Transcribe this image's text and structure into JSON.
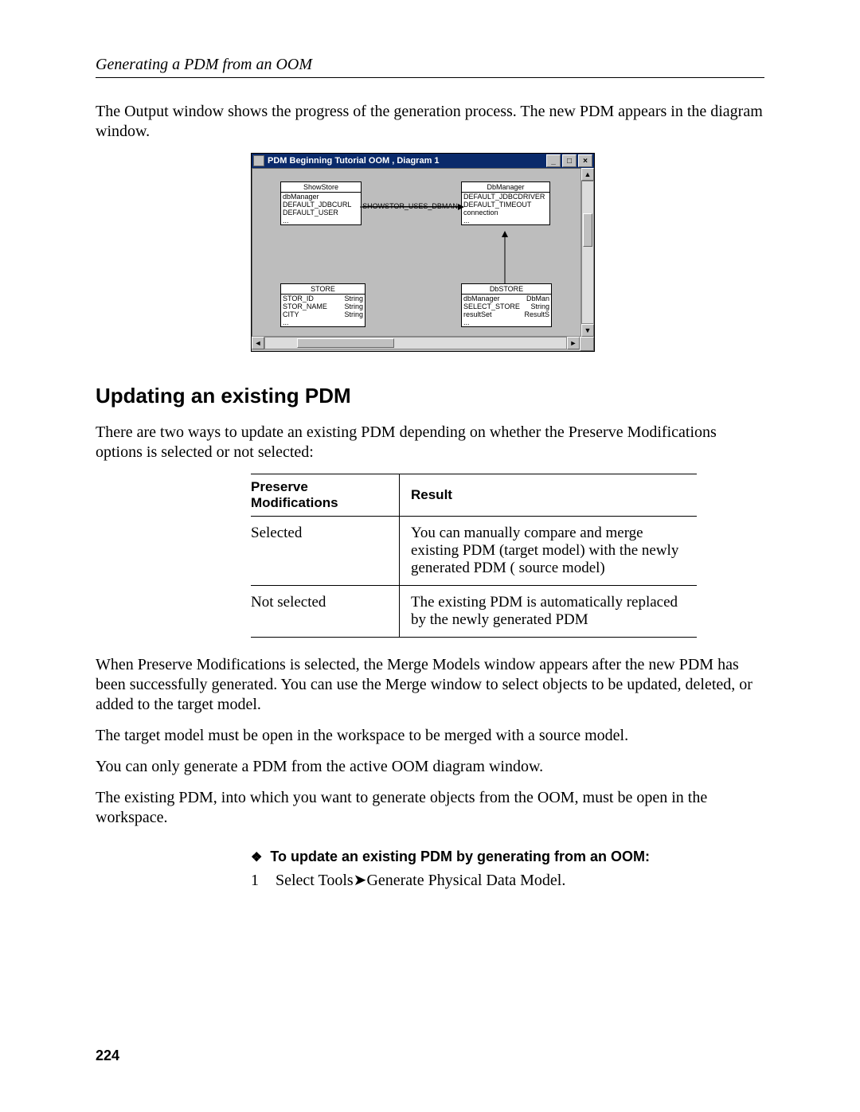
{
  "header": {
    "running": "Generating a PDM from an OOM"
  },
  "intro": "The Output window shows the progress of the generation process. The new PDM appears in the diagram window.",
  "window": {
    "title": "PDM Beginning Tutorial OOM , Diagram 1",
    "buttons": {
      "min": "_",
      "max": "□",
      "close": "×"
    },
    "scroll": {
      "up": "▲",
      "down": "▼",
      "left": "◄",
      "right": "►"
    },
    "entities": {
      "showstore": {
        "name": "ShowStore",
        "rows": [
          "dbManager",
          "DEFAULT_JDBCURL",
          "DEFAULT_USER"
        ]
      },
      "dbmanager": {
        "name": "DbManager",
        "rows": [
          "DEFAULT_JDBCDRIVER",
          "DEFAULT_TIMEOUT",
          "connection"
        ]
      },
      "store": {
        "name": "STORE",
        "rows": [
          {
            "l": "STOR_ID",
            "r": "String"
          },
          {
            "l": "STOR_NAME",
            "r": "String"
          },
          {
            "l": "CITY",
            "r": "String"
          }
        ]
      },
      "dbstore": {
        "name": "DbSTORE",
        "rows": [
          {
            "l": "dbManager",
            "r": "DbMan"
          },
          {
            "l": "SELECT_STORE",
            "r": "String"
          },
          {
            "l": "resultSet",
            "r": "ResultS"
          }
        ]
      }
    },
    "link_label": "SHOWSTOR_USES_DBMAN"
  },
  "section_title": "Updating an existing PDM",
  "section_intro": "There are two ways to update an existing PDM depending on whether the Preserve Modifications options is selected or not selected:",
  "table": {
    "h1": "Preserve Modifications",
    "h2": "Result",
    "rows": [
      {
        "c1": "Selected",
        "c2": "You can manually compare and merge existing PDM (target model) with the newly generated PDM ( source model)"
      },
      {
        "c1": "Not selected",
        "c2": "The existing PDM is automatically replaced by the newly generated PDM"
      }
    ]
  },
  "paras": [
    "When Preserve Modifications is selected, the Merge Models window appears after the new PDM has been successfully generated. You can use the Merge window to select objects to be updated, deleted, or added to the target model.",
    "The target model must be open in the workspace to be merged with a source model.",
    "You can only generate a PDM from the active OOM diagram window.",
    "The existing PDM, into which you want to generate objects from the OOM, must be open in the workspace."
  ],
  "procedure": {
    "title": "To update an existing PDM by generating from an OOM:",
    "diamond": "❖",
    "arrow": "➤",
    "step_no": "1",
    "step_a": "Select Tools",
    "step_b": "Generate Physical Data Model."
  },
  "page_number": "224"
}
